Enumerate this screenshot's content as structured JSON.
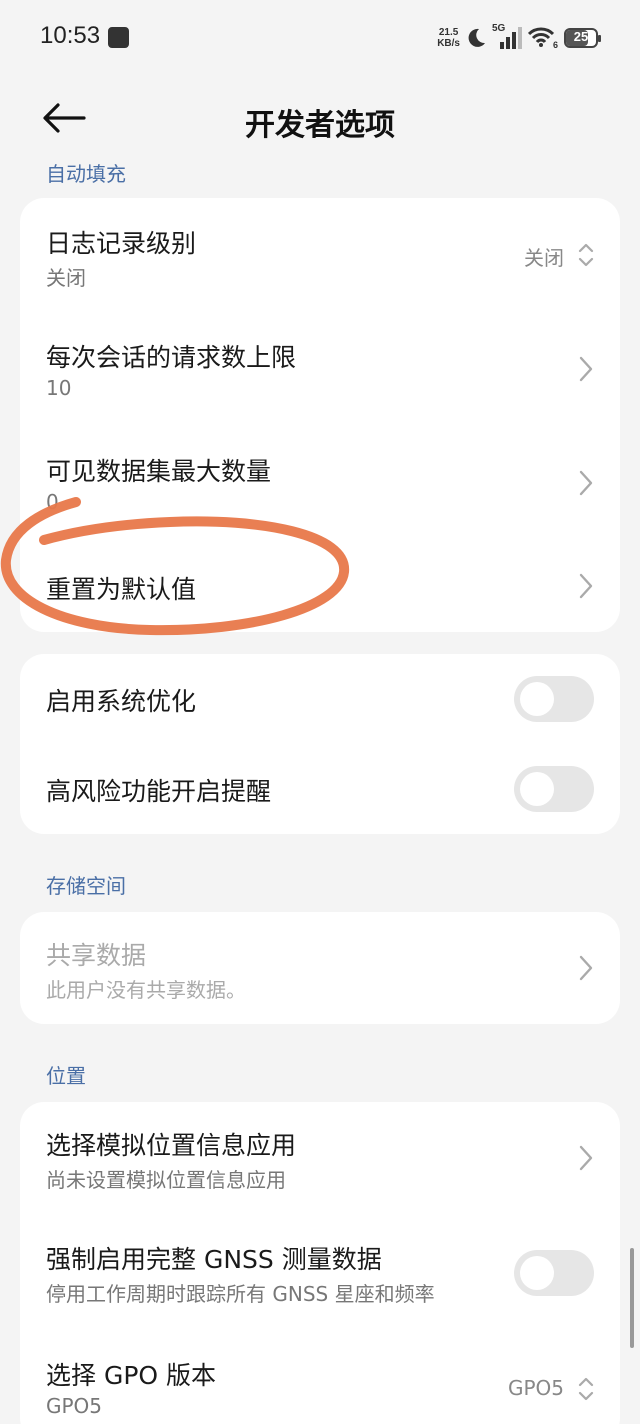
{
  "status_bar": {
    "time": "10:53",
    "net_speed_value": "21.5",
    "net_speed_unit": "KB/s",
    "network": "5G",
    "wifi_sub": "6",
    "battery": "25"
  },
  "header": {
    "title": "开发者选项"
  },
  "sections": {
    "autofill": "自动填充",
    "storage": "存储空间",
    "location": "位置"
  },
  "autofill_card": {
    "log_level": {
      "title": "日志记录级别",
      "subtitle": "关闭",
      "value": "关闭"
    },
    "max_requests": {
      "title": "每次会话的请求数上限",
      "subtitle": "10"
    },
    "max_datasets": {
      "title": "可见数据集最大数量",
      "subtitle": "0"
    },
    "reset": {
      "title": "重置为默认值"
    }
  },
  "system_card": {
    "system_opt": {
      "title": "启用系统优化",
      "enabled": false
    },
    "high_risk": {
      "title": "高风险功能开启提醒",
      "enabled": false
    }
  },
  "storage_card": {
    "shared_data": {
      "title": "共享数据",
      "subtitle": "此用户没有共享数据。"
    }
  },
  "location_card": {
    "mock_location": {
      "title": "选择模拟位置信息应用",
      "subtitle": "尚未设置模拟位置信息应用"
    },
    "gnss": {
      "title": "强制启用完整 GNSS 测量数据",
      "subtitle": "停用工作周期时跟踪所有 GNSS 星座和频率",
      "enabled": false
    },
    "gpo": {
      "title": "选择 GPO 版本",
      "subtitle": "GPO5",
      "value": "GPO5"
    }
  },
  "colors": {
    "background": "#f4f4f4",
    "section_label": "#4a6fa6",
    "annotation": "#e8784a"
  }
}
